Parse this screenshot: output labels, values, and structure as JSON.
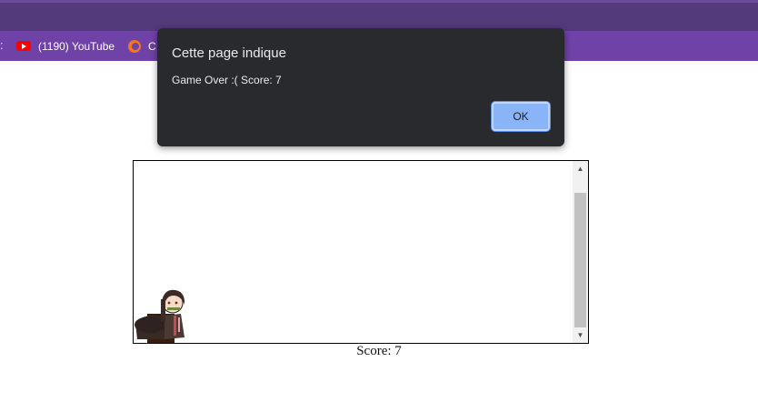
{
  "bookmarks": {
    "truncated_left": ":",
    "items": [
      {
        "label": "(1190) YouTube",
        "icon": "youtube-icon"
      },
      {
        "label": "C",
        "icon": "crunchyroll-icon"
      }
    ]
  },
  "dialog": {
    "title": "Cette page indique",
    "message": "Game Over :( Score: 7",
    "ok_label": "OK"
  },
  "game": {
    "score_text": "Score: 7"
  },
  "colors": {
    "browser_chrome": "#533a7b",
    "bookmarks_bar": "#6f42a8",
    "dialog_bg": "#292a2d",
    "ok_button": "#8ab4f8",
    "obstacle": "#3b1d0c"
  }
}
